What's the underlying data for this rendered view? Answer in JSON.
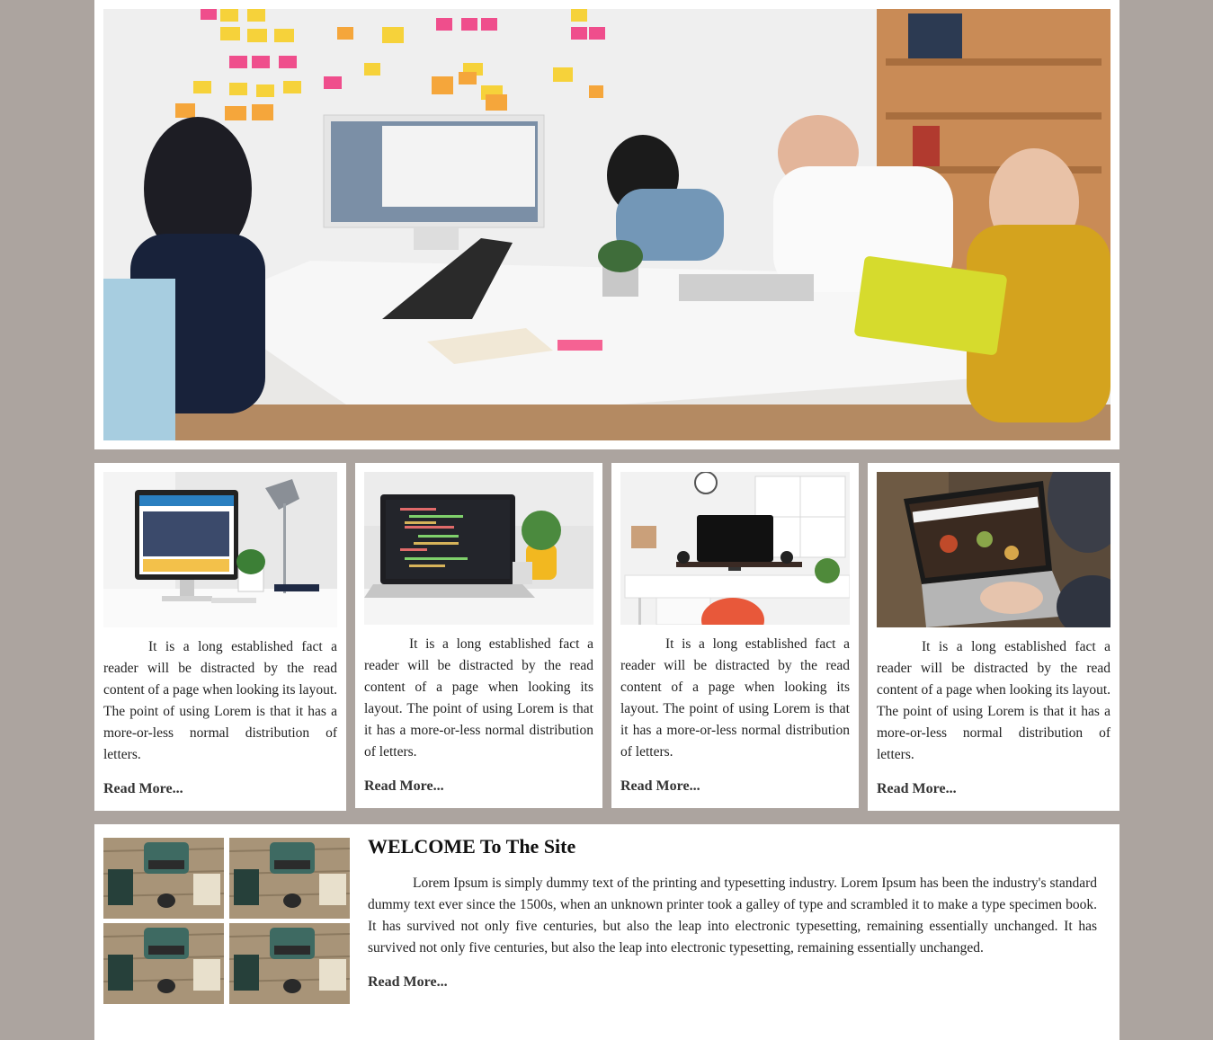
{
  "hero": {
    "image_alt": "team-meeting-photo"
  },
  "cards": [
    {
      "image": "desktop-monitor-on-white-desk-photo",
      "text": "It is a long established fact a reader will be distracted by the read content of a page when looking its layout. The point of using Lorem is that it has a more-or-less normal distribution of letters.",
      "link": "Read More..."
    },
    {
      "image": "laptop-with-code-photo",
      "text": "It is a long established fact a reader will be distracted by the read content of a page when looking its layout. The point of using Lorem is that it has a more-or-less normal distribution of letters.",
      "link": "Read More..."
    },
    {
      "image": "home-office-desk-photo",
      "text": "It is a long established fact a reader will be distracted by the read content of a page when looking its layout. The point of using Lorem is that it has a more-or-less normal distribution of letters.",
      "link": "Read More..."
    },
    {
      "image": "person-typing-on-laptop-photo",
      "text": "It is a long established fact a reader will be distracted by the read content of a page when looking its layout. The point of using Lorem is that it has a more-or-less normal distribution of letters.",
      "link": "Read More..."
    }
  ],
  "welcome": {
    "title": "WELCOME To The Site",
    "text": "Lorem Ipsum is simply dummy text of the printing and typesetting industry. Lorem Ipsum has been the industry's standard dummy text ever since the 1500s, when an unknown printer took a galley of type and scrambled it to make a type specimen book. It has survived not only five centuries, but also the leap into electronic typesetting, remaining essentially unchanged. It has survived not only five centuries, but also the leap into electronic typesetting, remaining essentially unchanged.",
    "link": "Read More...",
    "tile_image": "typewriter-on-wooden-table-photo"
  },
  "colors": {
    "page_background": "#aca49f",
    "panel_background": "#ffffff"
  }
}
